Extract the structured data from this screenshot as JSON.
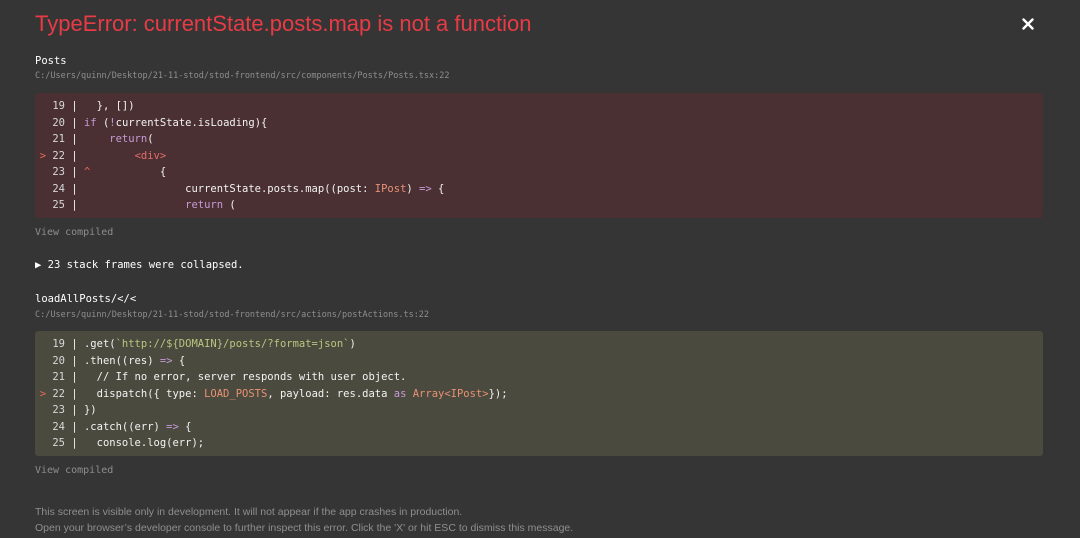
{
  "error": {
    "title": "TypeError: currentState.posts.map is not a function"
  },
  "colors": {
    "background": "#353535",
    "title": "#e83b46",
    "error_code_bg": "#4a3032",
    "source_code_bg": "#4b4a3e"
  },
  "frames": [
    {
      "name": "Posts",
      "path": "C:/Users/quinn/Desktop/21-11-stod/stod-frontend/src/components/Posts/Posts.tsx:22",
      "view_compiled": "View compiled",
      "lines": [
        {
          "num": "19",
          "marker": " ",
          "sep": "|",
          "code": "  }, [])"
        },
        {
          "num": "20",
          "marker": " ",
          "sep": "|",
          "code": "if (!currentState.isLoading){"
        },
        {
          "num": "21",
          "marker": " ",
          "sep": "|",
          "code": "    return("
        },
        {
          "num": "22",
          "marker": ">",
          "sep": "|",
          "code": "        <div>"
        },
        {
          "num": "23",
          "marker": " ",
          "sep": "|",
          "caret": "^",
          "code": "           {"
        },
        {
          "num": "24",
          "marker": " ",
          "sep": "|",
          "code": "                currentState.posts.map((post: IPost) => {"
        },
        {
          "num": "25",
          "marker": " ",
          "sep": "|",
          "code": "                return ("
        }
      ]
    },
    {
      "name": "loadAllPosts/</<",
      "path": "C:/Users/quinn/Desktop/21-11-stod/stod-frontend/src/actions/postActions.ts:22",
      "view_compiled": "View compiled",
      "lines": [
        {
          "num": "19",
          "marker": " ",
          "sep": "|",
          "code": ".get(`http://${DOMAIN}/posts/?format=json`)"
        },
        {
          "num": "20",
          "marker": " ",
          "sep": "|",
          "code": ".then((res) => {"
        },
        {
          "num": "21",
          "marker": " ",
          "sep": "|",
          "code": "  // If no error, server responds with user object."
        },
        {
          "num": "22",
          "marker": ">",
          "sep": "|",
          "code": "  dispatch({ type: LOAD_POSTS, payload: res.data as Array<IPost>});"
        },
        {
          "num": "23",
          "marker": " ",
          "sep": "|",
          "code": "})"
        },
        {
          "num": "24",
          "marker": " ",
          "sep": "|",
          "code": ".catch((err) => {"
        },
        {
          "num": "25",
          "marker": " ",
          "sep": "|",
          "code": "  console.log(err);"
        }
      ]
    }
  ],
  "collapsed": {
    "arrow": "▶",
    "text": "23 stack frames were collapsed."
  },
  "footer": {
    "line1": "This screen is visible only in development. It will not appear if the app crashes in production.",
    "line2": "Open your browser’s developer console to further inspect this error.  Click the 'X' or hit ESC to dismiss this message."
  }
}
